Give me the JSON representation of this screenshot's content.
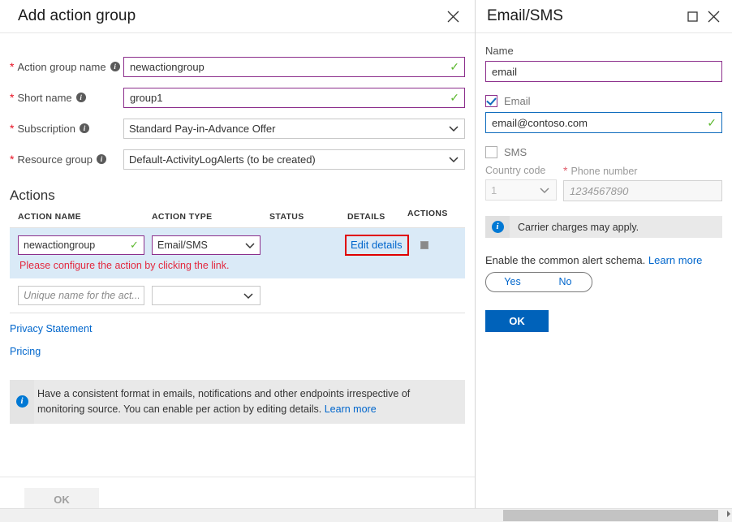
{
  "left_blade": {
    "title": "Add action group",
    "close_icon": "close-icon",
    "fields": [
      {
        "label": "Action group name",
        "value": "newactiongroup",
        "required": true,
        "info": true,
        "state": "valid",
        "type": "text"
      },
      {
        "label": "Short name",
        "value": "group1",
        "required": true,
        "info": true,
        "state": "valid",
        "type": "text"
      },
      {
        "label": "Subscription",
        "value": "Standard Pay-in-Advance Offer",
        "required": true,
        "info": true,
        "state": "normal",
        "type": "select"
      },
      {
        "label": "Resource group",
        "value": "Default-ActivityLogAlerts (to be created)",
        "required": true,
        "info": true,
        "state": "normal",
        "type": "select"
      }
    ],
    "actions_section": {
      "heading": "Actions",
      "columns": [
        "ACTION NAME",
        "ACTION TYPE",
        "STATUS",
        "DETAILS",
        "ACTIONS"
      ],
      "rows": [
        {
          "action_name": "newactiongroup",
          "action_type": "Email/SMS",
          "status": "",
          "details_link": "Edit details",
          "error": "Please configure the action by clicking the link.",
          "highlighted": true
        },
        {
          "action_name_placeholder": "Unique name for the act...",
          "action_type": "",
          "status": "",
          "details_link": ""
        }
      ]
    },
    "links": [
      {
        "label": "Privacy Statement"
      },
      {
        "label": "Pricing"
      }
    ],
    "info_box": {
      "text": "Have a consistent format in emails, notifications and other endpoints irrespective of monitoring source. You can enable per action by editing details.",
      "link": "Learn more"
    },
    "footer": {
      "ok_label": "OK",
      "ok_disabled": true
    }
  },
  "right_blade": {
    "title": "Email/SMS",
    "maximize_icon": "maximize-icon",
    "close_icon": "close-icon",
    "name_label": "Name",
    "name_value": "email",
    "email_checkbox": {
      "label": "Email",
      "checked": true
    },
    "email_value": "email@contoso.com",
    "sms_checkbox": {
      "label": "SMS",
      "checked": false
    },
    "country_code_label": "Country code",
    "country_code_value": "1",
    "phone_label": "Phone number",
    "phone_placeholder": "1234567890",
    "carrier_note": "Carrier charges may apply.",
    "schema_text": "Enable the common alert schema.",
    "schema_link": "Learn more",
    "toggle": {
      "yes": "Yes",
      "no": "No",
      "selected": "No"
    },
    "ok_label": "OK"
  },
  "colors": {
    "accent_blue": "#0062ba",
    "link_blue": "#0066cc",
    "validation_purple": "#8c2f8c",
    "success_green": "#5cb82e",
    "error_red": "#e3283e",
    "highlight_red": "#e00000",
    "row_highlight": "#daeaf7"
  }
}
